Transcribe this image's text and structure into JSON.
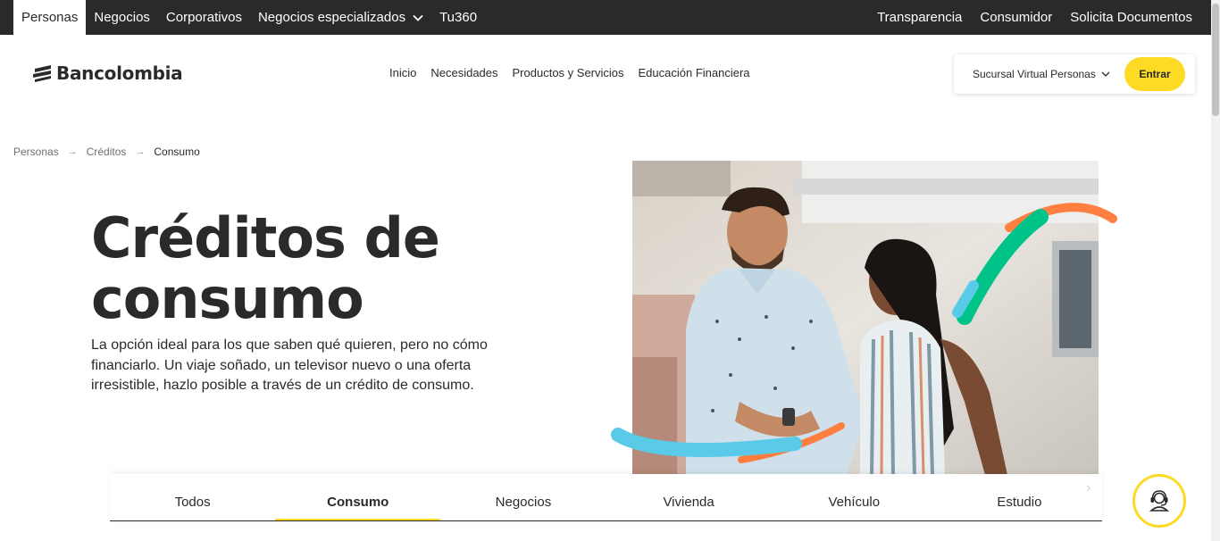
{
  "topbar": {
    "left_items": [
      {
        "label": "Personas",
        "active": true
      },
      {
        "label": "Negocios",
        "active": false
      },
      {
        "label": "Corporativos",
        "active": false
      },
      {
        "label": "Negocios especializados",
        "active": false
      },
      {
        "label": "Tu360",
        "active": false
      }
    ],
    "right_items": [
      {
        "label": "Transparencia"
      },
      {
        "label": "Consumidor"
      },
      {
        "label": "Solicita Documentos"
      }
    ]
  },
  "header": {
    "logo_text": "Bancolombia",
    "nav": [
      {
        "label": "Inicio"
      },
      {
        "label": "Necesidades"
      },
      {
        "label": "Productos y Servicios"
      },
      {
        "label": "Educación Financiera"
      }
    ],
    "sucursal_label": "Sucursal Virtual Personas",
    "entrar_label": "Entrar"
  },
  "breadcrumb": [
    {
      "label": "Personas"
    },
    {
      "label": "Créditos"
    },
    {
      "label": "Consumo"
    }
  ],
  "hero": {
    "title": "Créditos de consumo",
    "description": "La opción ideal para los que saben qué quieren, pero no cómo financiarlo. Un viaje soñado, un televisor nuevo o una oferta irresistible, hazlo posible a través de un crédito de consumo."
  },
  "tabs": [
    {
      "label": "Todos",
      "active": false
    },
    {
      "label": "Consumo",
      "active": true
    },
    {
      "label": "Negocios",
      "active": false
    },
    {
      "label": "Vivienda",
      "active": false
    },
    {
      "label": "Vehículo",
      "active": false
    },
    {
      "label": "Estudio",
      "active": false
    }
  ],
  "icons": {
    "chat": "headset-icon",
    "chevron": "chevron-down-icon",
    "arrow": "arrow-right-icon",
    "tabs_next": "chevron-right-icon"
  },
  "colors": {
    "dark": "#2c2a29",
    "brand_yellow": "#fdda24",
    "accent_green": "#00c389",
    "accent_orange": "#ff7f41",
    "accent_blue": "#59cbe8"
  }
}
